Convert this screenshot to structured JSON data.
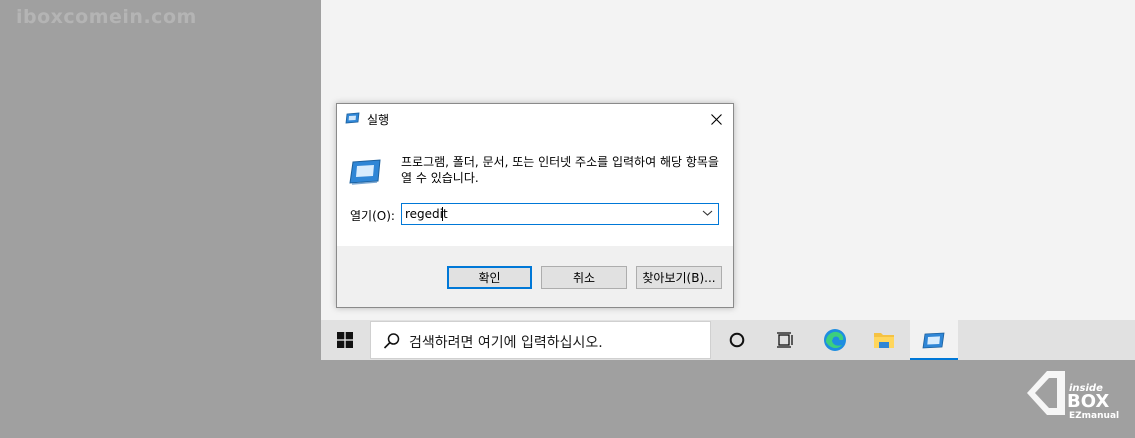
{
  "watermark": {
    "text": "iboxcomein.com"
  },
  "dialog": {
    "title": "실행",
    "description": "프로그램, 폴더, 문서, 또는 인터넷 주소를 입력하여 해당 항목을 열 수 있습니다.",
    "open_label": "열기(O):",
    "open_value": "regedit",
    "buttons": {
      "ok": "확인",
      "cancel": "취소",
      "browse": "찾아보기(B)..."
    }
  },
  "taskbar": {
    "search_placeholder": "검색하려면 여기에 입력하십시오.",
    "items": [
      "start-icon",
      "cortana-icon",
      "task-view-icon",
      "edge-icon",
      "file-explorer-icon",
      "run-icon"
    ]
  },
  "brand_logo": {
    "line1": "inside",
    "line2": "BOX",
    "line3": "EZmanual"
  },
  "colors": {
    "accent": "#0078d7",
    "taskbar": "#e1e1e1",
    "desktop": "#f3f3f3",
    "backdrop": "#a0a0a0"
  }
}
